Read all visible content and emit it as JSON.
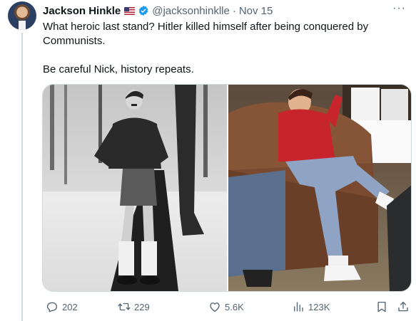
{
  "author": {
    "name": "Jackson Hinkle",
    "handle": "@jacksonhinklle",
    "separator": "·",
    "timestamp": "Nov 15",
    "more": "···"
  },
  "post": {
    "line1": "What heroic last stand? Hitler killed himself after being conquered by Communists.",
    "line2": "Be careful Nick, history repeats."
  },
  "stats": {
    "replies": "202",
    "reposts": "229",
    "likes": "5.6K",
    "views": "123K"
  },
  "colors": {
    "text": "#0f1419",
    "muted": "#536471",
    "verified": "#1d9bf0",
    "border": "#cfd9de"
  },
  "icons": [
    "reply-icon",
    "repost-icon",
    "like-icon",
    "views-icon",
    "bookmark-icon",
    "share-icon",
    "verified-icon",
    "us-flag-icon"
  ]
}
